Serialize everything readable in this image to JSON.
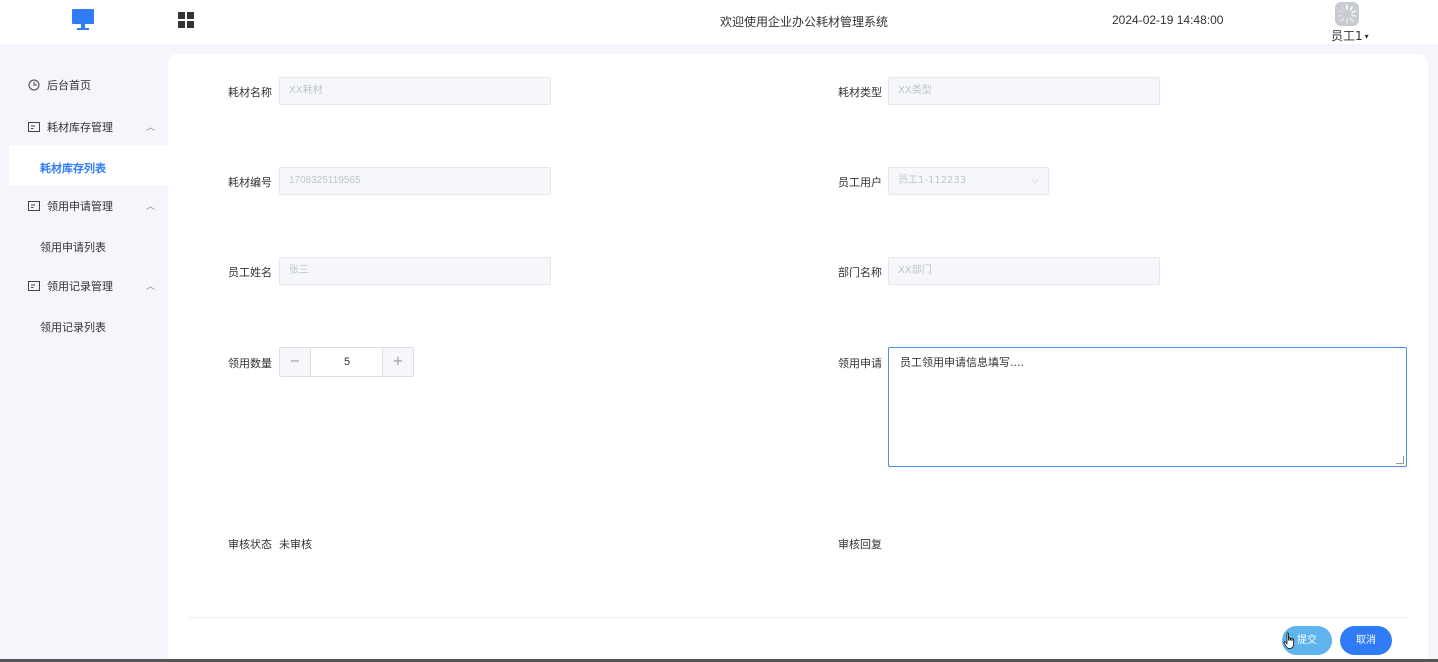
{
  "header": {
    "title": "欢迎使用企业办公耗材管理系统",
    "datetime": "2024-02-19 14:48:00",
    "user": "员工1"
  },
  "sidebar": {
    "items": [
      {
        "label": "后台首页",
        "icon": "clock-icon"
      },
      {
        "label": "耗材库存管理",
        "icon": "card-icon",
        "sub": "耗材库存列表"
      },
      {
        "label": "领用申请管理",
        "icon": "card-icon",
        "sub": "领用申请列表"
      },
      {
        "label": "领用记录管理",
        "icon": "card-icon",
        "sub": "领用记录列表"
      }
    ]
  },
  "form": {
    "material_name": {
      "label": "耗材名称",
      "placeholder": "XX耗材"
    },
    "material_type": {
      "label": "耗材类型",
      "placeholder": "XX类型"
    },
    "material_code": {
      "label": "耗材编号",
      "value": "1708325119565"
    },
    "employee_user": {
      "label": "员工用户",
      "value": "员工1-112233"
    },
    "employee_name": {
      "label": "员工姓名",
      "placeholder": "张三"
    },
    "department": {
      "label": "部门名称",
      "placeholder": "XX部门"
    },
    "quantity": {
      "label": "领用数量",
      "value": "5",
      "minus": "−",
      "plus": "+"
    },
    "application": {
      "label": "领用申请",
      "value": "员工领用申请信息填写...."
    },
    "review_status": {
      "label": "审核状态",
      "value": "未审核"
    },
    "review_reply": {
      "label": "审核回复",
      "value": ""
    }
  },
  "actions": {
    "submit": "提交",
    "cancel": "取消"
  },
  "colors": {
    "accent": "#2f7cf6",
    "submit": "#5fb4ee"
  }
}
